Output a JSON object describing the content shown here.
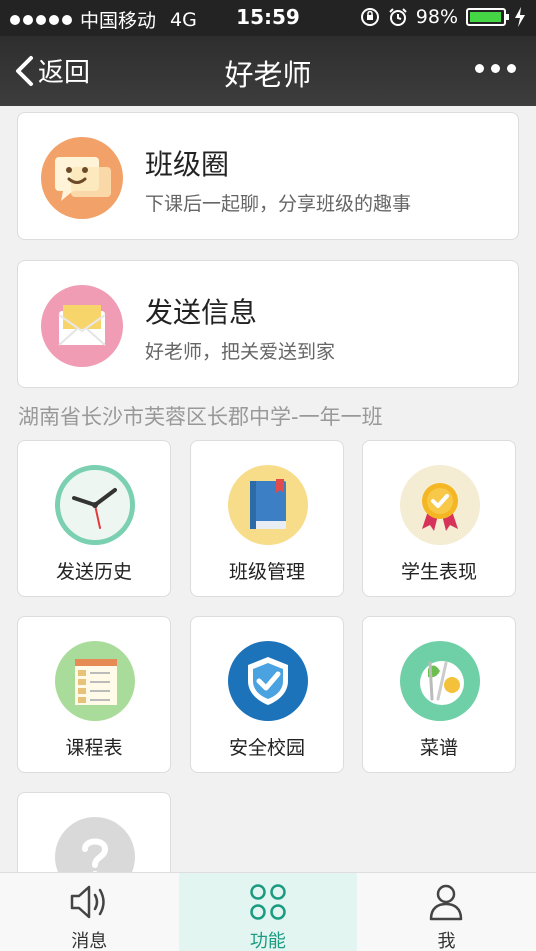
{
  "status": {
    "carrier": "中国移动",
    "network": "4G",
    "time": "15:59",
    "battery": "98%",
    "battery_level": 0.98
  },
  "nav": {
    "back_label": "返回",
    "title": "好老师",
    "more_icon": "more-dots-icon"
  },
  "features": [
    {
      "title": "班级圈",
      "desc": "下课后一起聊，分享班级的趣事",
      "icon": "chat-face-icon",
      "color": "#f2a269"
    },
    {
      "title": "发送信息",
      "desc": "好老师，把关爱送到家",
      "icon": "envelope-icon",
      "color": "#f09cb4"
    }
  ],
  "school_name": "湖南省长沙市芙蓉区长郡中学-一年一班",
  "tiles": [
    {
      "label": "发送历史",
      "icon": "clock-icon"
    },
    {
      "label": "班级管理",
      "icon": "book-icon"
    },
    {
      "label": "学生表现",
      "icon": "medal-icon"
    },
    {
      "label": "课程表",
      "icon": "schedule-icon"
    },
    {
      "label": "安全校园",
      "icon": "shield-check-icon"
    },
    {
      "label": "菜谱",
      "icon": "menu-plate-icon"
    },
    {
      "label": "",
      "icon": "question-icon"
    }
  ],
  "tabbar": [
    {
      "label": "消息",
      "icon": "speaker-icon",
      "active": false
    },
    {
      "label": "功能",
      "icon": "grid-icon",
      "active": true
    },
    {
      "label": "我",
      "icon": "person-icon",
      "active": false
    }
  ],
  "colors": {
    "accent": "#1a9b82",
    "navbar": "#333333"
  }
}
